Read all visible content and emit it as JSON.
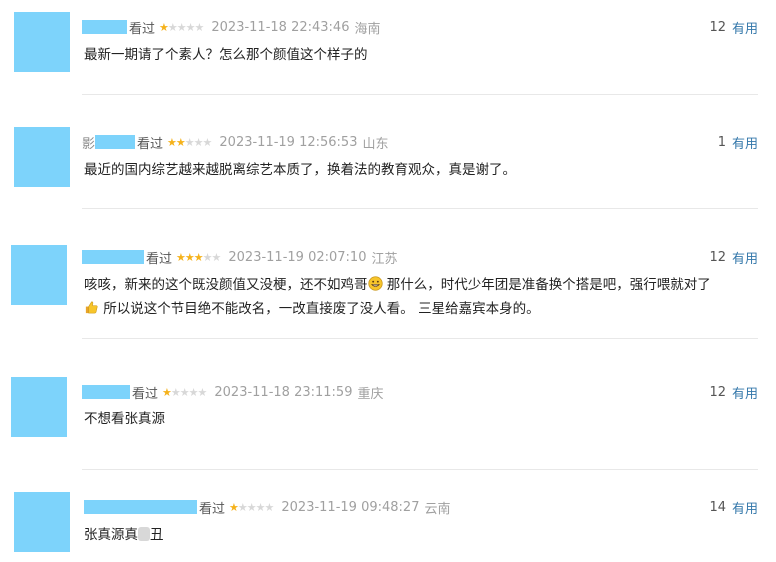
{
  "comments": [
    {
      "name_prefix": "",
      "watched": "看过",
      "rating": 1,
      "time": "2023-11-18 22:43:46",
      "location": "海南",
      "vote_count": "12",
      "vote_label": "有用",
      "text": "最新一期请了个素人？怎么那个颜值这个样子的"
    },
    {
      "name_prefix": "影",
      "watched": "看过",
      "rating": 2,
      "time": "2023-11-19 12:56:53",
      "location": "山东",
      "vote_count": "1",
      "vote_label": "有用",
      "text": "最近的国内综艺越来越脱离综艺本质了，换着法的教育观众，真是谢了。"
    },
    {
      "name_prefix": "",
      "watched": "看过",
      "rating": 3,
      "time": "2023-11-19 02:07:10",
      "location": "江苏",
      "vote_count": "12",
      "vote_label": "有用",
      "text_a": "咳咳，新来的这个既没颜值又没梗，还不如鸡哥",
      "text_b": "那什么，时代少年团是准备换个搭是吧，强行喂就对了",
      "text_c": "所以说这个节目绝不能改名，一改直接废了没人看。 三星给嘉宾本身的。"
    },
    {
      "name_prefix": "",
      "watched": "看过",
      "rating": 1,
      "time": "2023-11-18 23:11:59",
      "location": "重庆",
      "vote_count": "12",
      "vote_label": "有用",
      "text": "不想看张真源"
    },
    {
      "name_prefix": "",
      "watched": "看过",
      "rating": 1,
      "time": "2023-11-19 09:48:27",
      "location": "云南",
      "vote_count": "14",
      "vote_label": "有用",
      "text_a": "张真源真",
      "text_b": "丑"
    }
  ],
  "colors": {
    "avatar": "#7dd3fb",
    "star_on": "#f5b21b",
    "star_off": "#d8d8d8",
    "link": "#3377aa"
  },
  "icons": {
    "grin_emoji": "grinning-face-icon",
    "thumbs_up_emoji": "thumbs-up-icon"
  }
}
